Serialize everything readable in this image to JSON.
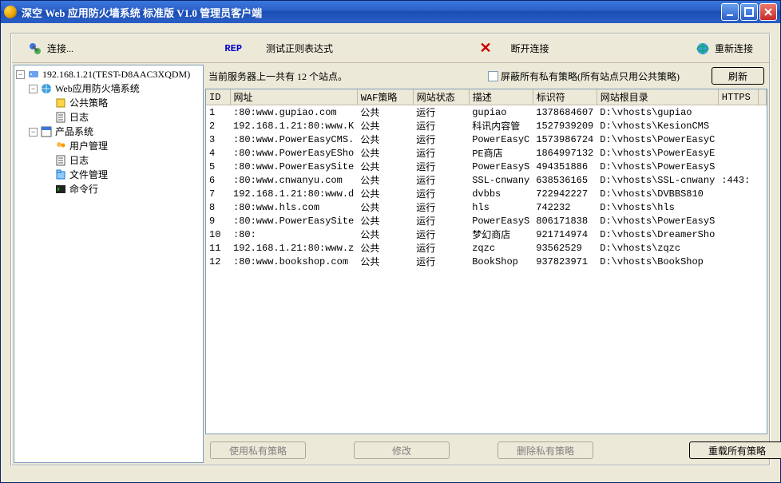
{
  "window": {
    "title": "深空 Web 应用防火墙系统 标准版 V1.0 管理员客户端"
  },
  "toolbar": {
    "connect": "连接...",
    "rep": "REP",
    "test_regex": "测试正则表达式",
    "disconnect": "断开连接",
    "reconnect": "重新连接"
  },
  "tree": {
    "root": "192.168.1.21(TEST-D8AAC3XQDM)",
    "waf_system": "Web应用防火墙系统",
    "waf_policy": "公共策略",
    "waf_log": "日志",
    "prod_system": "产品系统",
    "prod_user": "用户管理",
    "prod_log": "日志",
    "prod_file": "文件管理",
    "prod_cmd": "命令行"
  },
  "status": {
    "summary_pre": "当前服务器上一共有 ",
    "summary_count": "12",
    "summary_post": " 个站点。",
    "mask_label": "屏蔽所有私有策略(所有站点只用公共策略)",
    "refresh": "刷新"
  },
  "columns": {
    "id": "ID",
    "url": "网址",
    "waf": "WAF策略",
    "state": "网站状态",
    "desc": "描述",
    "tag": "标识符",
    "root": "网站根目录",
    "https": "HTTPS"
  },
  "rows": [
    {
      "id": "1",
      "url": ":80:www.gupiao.com",
      "waf": "公共",
      "state": "运行",
      "desc": "gupiao",
      "tag": "1378684607",
      "root": "D:\\vhosts\\gupiao",
      "https": ""
    },
    {
      "id": "2",
      "url": "192.168.1.21:80:www.K",
      "waf": "公共",
      "state": "运行",
      "desc": "科讯内容管",
      "tag": "1527939209",
      "root": "D:\\vhosts\\KesionCMS",
      "https": ""
    },
    {
      "id": "3",
      "url": ":80:www.PowerEasyCMS.",
      "waf": "公共",
      "state": "运行",
      "desc": "PowerEasyC",
      "tag": "1573986724",
      "root": "D:\\vhosts\\PowerEasyC",
      "https": ""
    },
    {
      "id": "4",
      "url": ":80:www.PowerEasyESho",
      "waf": "公共",
      "state": "运行",
      "desc": "PE商店",
      "tag": "1864997132",
      "root": "D:\\vhosts\\PowerEasyE",
      "https": ""
    },
    {
      "id": "5",
      "url": ":80:www.PowerEasySite",
      "waf": "公共",
      "state": "运行",
      "desc": "PowerEasyS",
      "tag": "494351886",
      "root": "D:\\vhosts\\PowerEasyS",
      "https": ""
    },
    {
      "id": "6",
      "url": ":80:www.cnwanyu.com",
      "waf": "公共",
      "state": "运行",
      "desc": "SSL-cnwany",
      "tag": "638536165",
      "root": "D:\\vhosts\\SSL-cnwany",
      "https": ":443:"
    },
    {
      "id": "7",
      "url": "192.168.1.21:80:www.d",
      "waf": "公共",
      "state": "运行",
      "desc": "dvbbs",
      "tag": "722942227",
      "root": "D:\\vhosts\\DVBBS810",
      "https": ""
    },
    {
      "id": "8",
      "url": ":80:www.hls.com",
      "waf": "公共",
      "state": "运行",
      "desc": "hls",
      "tag": "742232",
      "root": "D:\\vhosts\\hls",
      "https": ""
    },
    {
      "id": "9",
      "url": ":80:www.PowerEasySite",
      "waf": "公共",
      "state": "运行",
      "desc": "PowerEasyS",
      "tag": "806171838",
      "root": "D:\\vhosts\\PowerEasyS",
      "https": ""
    },
    {
      "id": "10",
      "url": ":80:",
      "waf": "公共",
      "state": "运行",
      "desc": "梦幻商店",
      "tag": "921714974",
      "root": "D:\\vhosts\\DreamerSho",
      "https": ""
    },
    {
      "id": "11",
      "url": "192.168.1.21:80:www.z",
      "waf": "公共",
      "state": "运行",
      "desc": "zqzc",
      "tag": "93562529",
      "root": "D:\\vhosts\\zqzc",
      "https": ""
    },
    {
      "id": "12",
      "url": ":80:www.bookshop.com",
      "waf": "公共",
      "state": "运行",
      "desc": "BookShop",
      "tag": "937823971",
      "root": "D:\\vhosts\\BookShop",
      "https": ""
    }
  ],
  "buttons": {
    "use_private": "使用私有策略",
    "modify": "修改",
    "del_private": "删除私有策略",
    "reload_all": "重载所有策略"
  }
}
